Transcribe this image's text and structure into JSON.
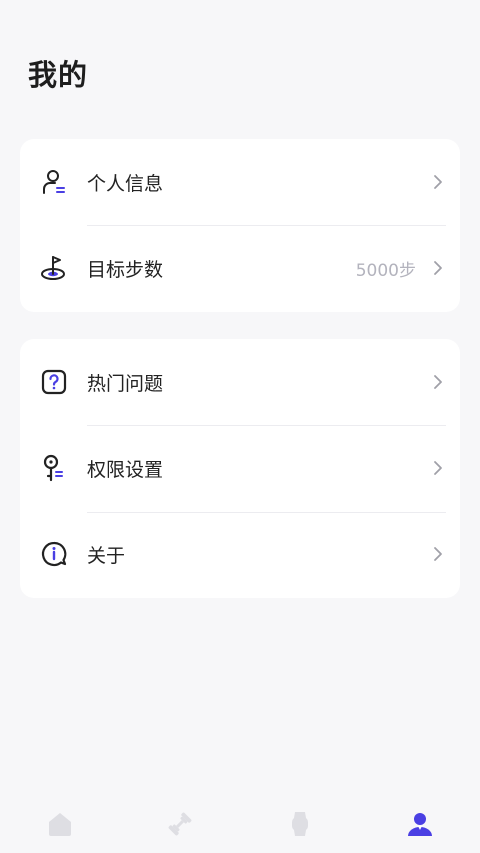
{
  "page": {
    "title": "我的"
  },
  "group1": [
    {
      "label": "个人信息",
      "value": "",
      "icon": "user-icon"
    },
    {
      "label": "目标步数",
      "value": "5000步",
      "icon": "target-flag-icon"
    }
  ],
  "group2": [
    {
      "label": "热门问题",
      "value": "",
      "icon": "question-icon"
    },
    {
      "label": "权限设置",
      "value": "",
      "icon": "key-icon"
    },
    {
      "label": "关于",
      "value": "",
      "icon": "info-icon"
    }
  ],
  "tabbar": [
    {
      "icon": "home-icon",
      "active": false
    },
    {
      "icon": "fitness-icon",
      "active": false
    },
    {
      "icon": "watch-icon",
      "active": false
    },
    {
      "icon": "profile-icon",
      "active": true
    }
  ],
  "colors": {
    "accent": "#4a3fe3",
    "inactive": "#dedee3",
    "background": "#f7f7f9"
  }
}
